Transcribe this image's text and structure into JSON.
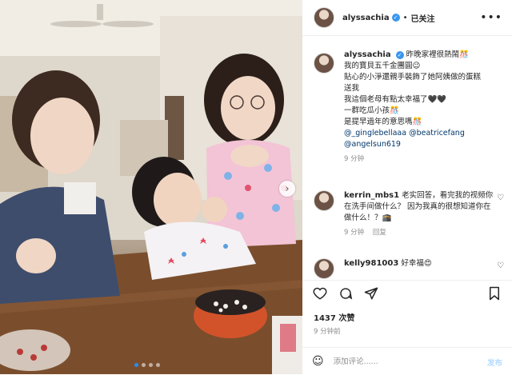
{
  "post": {
    "username": "alyssachia",
    "separator": "•",
    "follow_label": "已关注",
    "more_icon": "more-options-icon"
  },
  "caption": {
    "username": "alyssachia",
    "lines": [
      "昨晚家裡很熱鬧🎊",
      "我的寶貝五千金團圓😉",
      "貼心的小淨還親手裝飾了她阿姨做的蛋糕",
      "送我",
      "我這個老母有點太幸福了🖤🖤",
      "一群吃瓜小孩🎊",
      "是提早過年的意思嗎🎊"
    ],
    "mentions": [
      "@_ginglebellaaa",
      "@beatricefang",
      "@angelsun619"
    ],
    "time": "9 分钟"
  },
  "comments": [
    {
      "username": "kerrin_mbs1",
      "text": "老实回答，看完我的视频你在洗手间做什么？ 因为我真的很想知道你在做什么！？🕋",
      "time": "9 分钟",
      "reply_label": "回复"
    },
    {
      "username": "kelly981003",
      "text": "好幸福😍"
    }
  ],
  "likes": {
    "count_label": "1437 次赞"
  },
  "time_ago": "9 分钟前",
  "comment_box": {
    "placeholder": "添加评论......",
    "post_label": "发布"
  },
  "colors": {
    "link": "#00376b",
    "verified": "#3897f0",
    "post_disabled": "#b3dbff",
    "muted": "#8e8e8e"
  },
  "carousel": {
    "dots": 4,
    "active_index": 0
  }
}
